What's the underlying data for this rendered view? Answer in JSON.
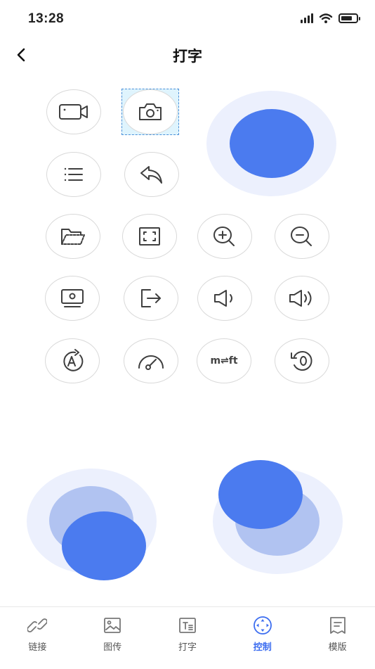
{
  "status_bar": {
    "time": "13:28",
    "icons": [
      "signal-icon",
      "wifi-icon",
      "battery-icon"
    ]
  },
  "header": {
    "title": "打字",
    "back_icon": "chevron-left-icon"
  },
  "controls": {
    "row1": [
      "video-camera-icon",
      "camera-icon"
    ],
    "row2": [
      "list-icon",
      "undo-icon"
    ],
    "row3": [
      "folder-icon",
      "fullscreen-icon",
      "zoom-in-icon",
      "zoom-out-icon"
    ],
    "row4": [
      "screen-icon",
      "exit-icon",
      "volume-down-icon",
      "volume-up-icon"
    ],
    "row5": [
      "auto-rotate-icon",
      "speed-icon",
      "unit-toggle",
      "reset-icon"
    ],
    "unit_toggle_label": "m⇌ft",
    "selected": "camera-icon"
  },
  "joysticks": [
    "top-right-joystick",
    "bottom-left-joystick",
    "bottom-right-joystick"
  ],
  "tabs": [
    {
      "label": "链接",
      "icon": "link-icon",
      "active": false
    },
    {
      "label": "图传",
      "icon": "image-icon",
      "active": false
    },
    {
      "label": "打字",
      "icon": "text-icon",
      "active": false
    },
    {
      "label": "控制",
      "icon": "gamepad-icon",
      "active": true
    },
    {
      "label": "模版",
      "icon": "template-icon",
      "active": false
    }
  ],
  "colors": {
    "accent": "#3d6ef0",
    "joystick_knob": "#4b7bef",
    "joystick_base": "#ecf0fd",
    "joystick_shadow": "#b1c3f1",
    "selection": "#dff4fd"
  }
}
